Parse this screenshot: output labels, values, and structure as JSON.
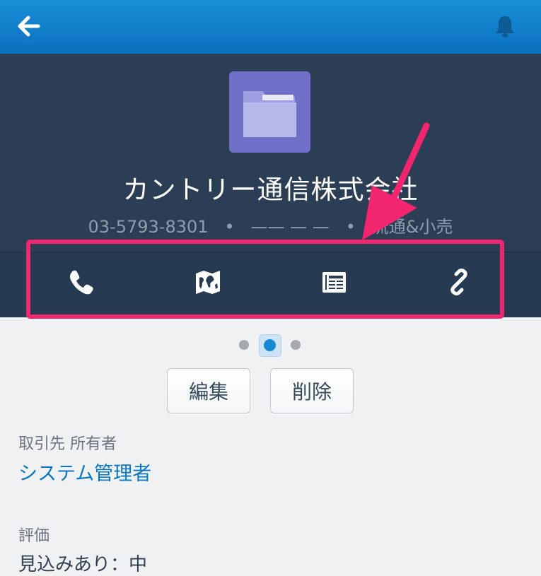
{
  "topbar": {
    "back_icon": "back-arrow-icon",
    "notification_icon": "bell-icon",
    "bar_color": "#1a8fd8"
  },
  "header": {
    "icon": "folder-icon",
    "icon_color": "#7070c9",
    "account_name": "カントリー通信株式会社",
    "phone": "03-5793-8301",
    "separator": "•",
    "placeholder": "—— — —",
    "industry": "流通&小売"
  },
  "actions": [
    {
      "icon": "phone-icon"
    },
    {
      "icon": "map-icon"
    },
    {
      "icon": "news-icon"
    },
    {
      "icon": "link-icon"
    }
  ],
  "annotation": {
    "highlight_color": "#f2266e",
    "arrow_icon": "pointer-arrow-icon"
  },
  "pager": {
    "page_count": 3,
    "active_index": 1,
    "active_color": "#1589d6"
  },
  "buttons": {
    "edit_label": "編集",
    "delete_label": "削除"
  },
  "fields": {
    "owner_label": "取引先 所有者",
    "owner_value": "システム管理者",
    "rating_label": "評価",
    "rating_value": "見込みあり：中"
  }
}
